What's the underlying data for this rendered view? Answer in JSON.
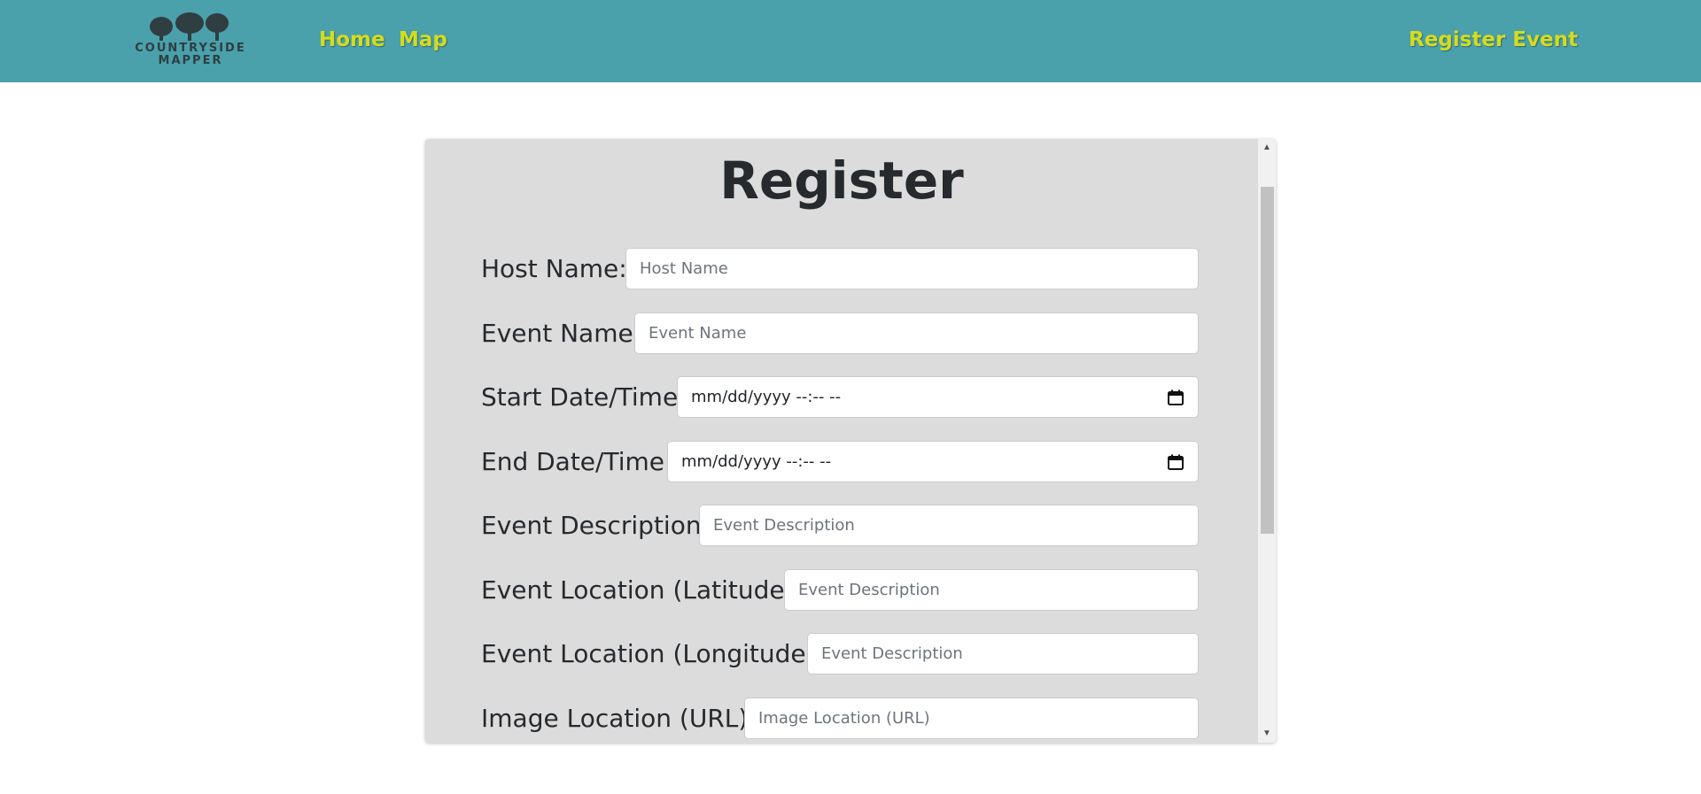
{
  "nav": {
    "logo_line1": "COUNTRYSIDE",
    "logo_line2": "MAPPER",
    "links": {
      "home": "Home",
      "map": "Map",
      "register_event": "Register Event"
    },
    "colors": {
      "background": "#4aa0ab",
      "link": "#d4dc1e"
    }
  },
  "form": {
    "title": "Register",
    "fields": {
      "host_name": {
        "label": "Host Name:",
        "placeholder": "Host Name"
      },
      "event_name": {
        "label": "Event Name:",
        "placeholder": "Event Name"
      },
      "start_datetime": {
        "label": "Start Date/Time:",
        "value": "mm/dd/yyyy --:-- --"
      },
      "end_datetime": {
        "label": "End Date/Time:",
        "value": "mm/dd/yyyy --:-- --"
      },
      "event_description": {
        "label": "Event Description:",
        "placeholder": "Event Description"
      },
      "latitude": {
        "label": "Event Location (Latitude):",
        "placeholder": "Event Description"
      },
      "longitude": {
        "label": "Event Location (Longitude):",
        "placeholder": "Event Description"
      },
      "image_url": {
        "label": "Image Location (URL):",
        "placeholder": "Image Location (URL)"
      }
    },
    "colors": {
      "card_background": "#dcdcdc"
    }
  },
  "icons": {
    "calendar": "calendar-icon",
    "scroll_up": "scroll-up-arrow-icon",
    "scroll_down": "scroll-down-arrow-icon"
  }
}
